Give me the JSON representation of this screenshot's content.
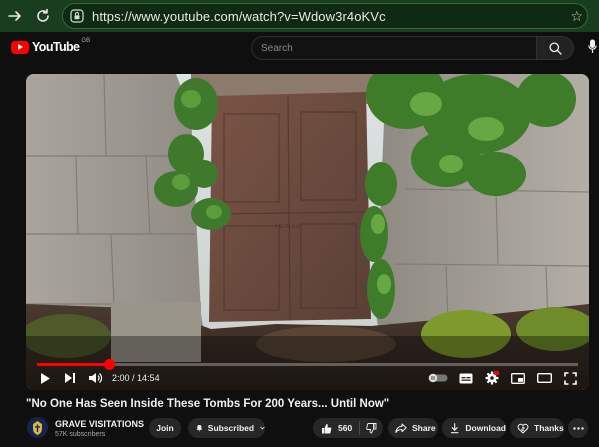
{
  "browser": {
    "url": "https://www.youtube.com/watch?v=Wdow3r4oKVc",
    "icons": [
      "forward-arrow-icon",
      "reload-icon",
      "lock-icon",
      "star-icon"
    ]
  },
  "header": {
    "logo_text": "YouTube",
    "country_code": "GB",
    "search_placeholder": "Search"
  },
  "player": {
    "time_current": "2:00",
    "time_separator": " / ",
    "time_total": "14:54",
    "progress": 0.134,
    "colors": {
      "progress": "#ff0000"
    }
  },
  "video": {
    "title": "\"No One Has Seen Inside These Tombs For 200 Years... Until Now\""
  },
  "channel": {
    "name": "GRAVE VISITATIONS",
    "subscribers": "57K subscribers"
  },
  "actions": {
    "join": "Join",
    "subscribed": "Subscribed",
    "likes": "560",
    "share": "Share",
    "download": "Download",
    "thanks": "Thanks"
  }
}
